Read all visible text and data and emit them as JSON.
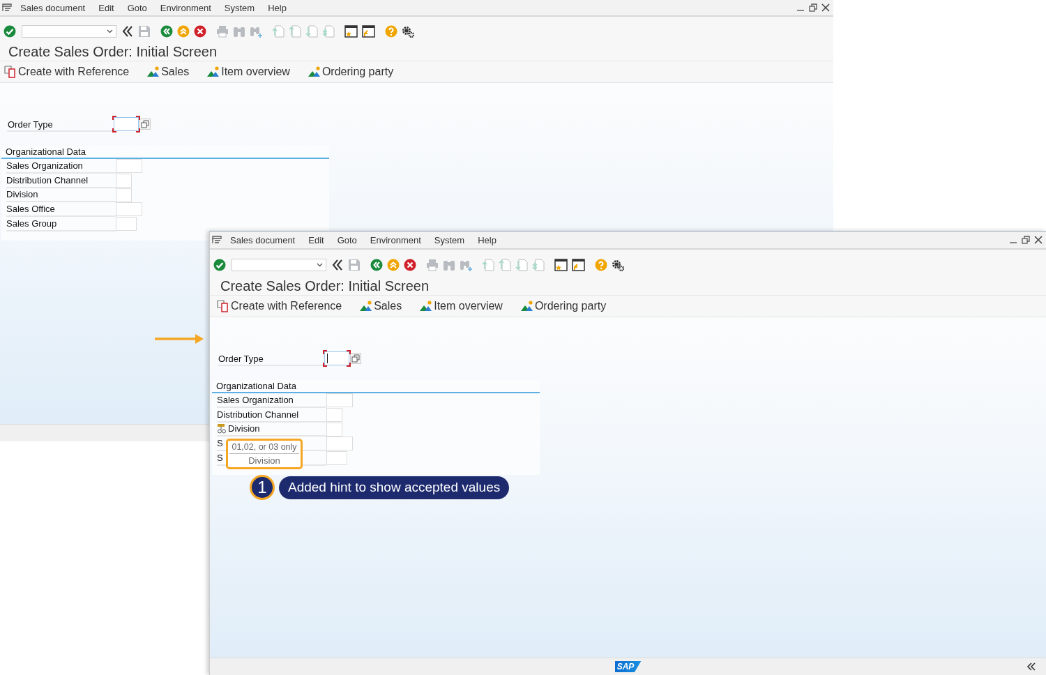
{
  "windows": [
    {
      "menu": [
        "Sales document",
        "Edit",
        "Goto",
        "Environment",
        "System",
        "Help"
      ],
      "title": "Create Sales Order: Initial Screen",
      "app_toolbar": [
        {
          "label": "Create with Reference",
          "kind": "reference"
        },
        {
          "label": "Sales",
          "kind": "overview"
        },
        {
          "label": "Item overview",
          "kind": "overview"
        },
        {
          "label": "Ordering party",
          "kind": "overview"
        }
      ],
      "order_type": {
        "label": "Order Type",
        "caret": false
      },
      "org_data": {
        "title": "Organizational Data",
        "fields": [
          {
            "label": "Sales Organization",
            "hint": false
          },
          {
            "label": "Distribution Channel",
            "hint": false
          },
          {
            "label": "Division",
            "hint": false
          },
          {
            "label": "Sales Office",
            "hint": false
          },
          {
            "label": "Sales Group",
            "hint": false
          }
        ]
      }
    },
    {
      "menu": [
        "Sales document",
        "Edit",
        "Goto",
        "Environment",
        "System",
        "Help"
      ],
      "title": "Create Sales Order: Initial Screen",
      "app_toolbar": [
        {
          "label": "Create with Reference",
          "kind": "reference"
        },
        {
          "label": "Sales",
          "kind": "overview"
        },
        {
          "label": "Item overview",
          "kind": "overview"
        },
        {
          "label": "Ordering party",
          "kind": "overview"
        }
      ],
      "order_type": {
        "label": "Order Type",
        "caret": true
      },
      "org_data": {
        "title": "Organizational Data",
        "fields": [
          {
            "label": "Sales Organization",
            "hint": false
          },
          {
            "label": "Distribution Channel",
            "hint": false
          },
          {
            "label": "Division",
            "hint": true
          },
          {
            "label": "S",
            "hint": false
          },
          {
            "label": "S",
            "hint": false
          }
        ]
      },
      "tooltip": {
        "hint": "01,02, or 03 only",
        "field": "Division"
      },
      "status_bar": {
        "logo": "SAP"
      }
    }
  ],
  "callout": {
    "number": "1",
    "text": "Added hint to show accepted values"
  }
}
